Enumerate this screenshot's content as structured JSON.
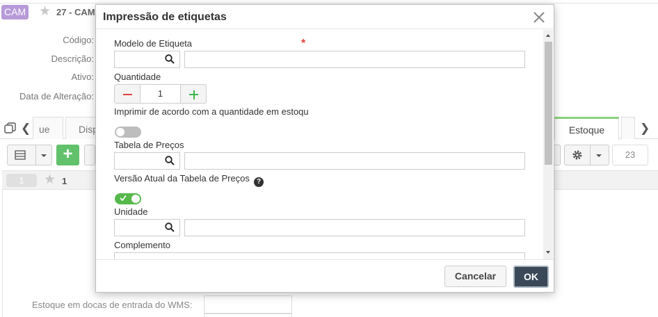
{
  "background": {
    "badge": "CAM",
    "record_title": "27 - CAM",
    "labels": {
      "codigo": "Código:",
      "descricao": "Descrição:",
      "ativo": "Ativo:",
      "data_alteracao": "Data de Alteração:"
    },
    "tabs": {
      "first": "ue",
      "second": "Disp",
      "active": "Estoque"
    },
    "record_count": "23",
    "page_number": "1",
    "grid_first_col": "1",
    "wms_label": "Estoque em docas de entrada do WMS:"
  },
  "modal": {
    "title": "Impressão de etiquetas",
    "fields": {
      "modelo": {
        "label": "Modelo de Etiqueta",
        "required_mark": "*",
        "code": "",
        "description": ""
      },
      "quantidade": {
        "label": "Quantidade",
        "value": "1"
      },
      "imprimir_estoque": {
        "label": "Imprimir de acordo com a quantidade em estoqu",
        "enabled": false
      },
      "tabela_precos": {
        "label": "Tabela de Preços",
        "code": "",
        "description": ""
      },
      "versao_atual": {
        "label": "Versão Atual da Tabela de Preços",
        "help": "?",
        "enabled": true
      },
      "unidade": {
        "label": "Unidade",
        "code": "",
        "description": ""
      },
      "complemento": {
        "label": "Complemento",
        "value": ""
      }
    },
    "buttons": {
      "cancel": "Cancelar",
      "ok": "OK"
    }
  },
  "colors": {
    "accent_green": "#56b84b",
    "required_red": "#e0463f",
    "ok_button": "#3a4858",
    "badge_purple": "#b79ad8",
    "active_tab_border": "#8bd17c"
  }
}
